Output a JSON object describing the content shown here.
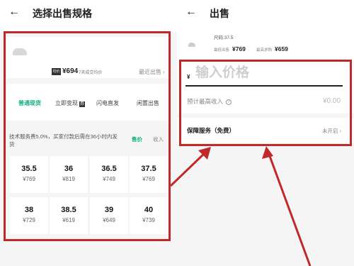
{
  "left": {
    "back_icon": "←",
    "title": "选择出售规格",
    "avg_badge": "均价",
    "avg_price": "¥694",
    "avg_label": "7天成交均价",
    "recent_sales": "最近出售",
    "recent_chevron": "›",
    "tabs": [
      {
        "label": "普通现货",
        "active": true
      },
      {
        "label": "立即变现",
        "badge": "券"
      },
      {
        "label": "闪电直发"
      },
      {
        "label": "闲置出售"
      }
    ],
    "fee_text": "技术服务费5.0%，买家付款后需在36小时内发货",
    "toggle_price": "售价",
    "toggle_receive": "收入",
    "sizes": [
      {
        "size": "35.5",
        "price": "¥769"
      },
      {
        "size": "36",
        "price": "¥819"
      },
      {
        "size": "36.5",
        "price": "¥749"
      },
      {
        "size": "37.5",
        "price": "¥769"
      },
      {
        "size": "38",
        "price": "¥729"
      },
      {
        "size": "38.5",
        "price": "¥619"
      },
      {
        "size": "39",
        "price": "¥649"
      },
      {
        "size": "40",
        "price": "¥739"
      }
    ]
  },
  "right": {
    "back_icon": "←",
    "title": "出售",
    "size_label": "尺码:37.5",
    "lowest_label": "最低出售",
    "lowest_value": "¥769",
    "highest_label": "最高求购",
    "highest_value": "¥659",
    "currency": "¥",
    "price_placeholder": "输入价格",
    "income_label": "预计最高收入",
    "income_value": "¥0.00",
    "help_icon": "?",
    "guarantee_label": "保障服务（免费）",
    "guarantee_value": "未开启 ›"
  },
  "colors": {
    "accent": "#0fae86",
    "annotation": "#c0292a"
  }
}
